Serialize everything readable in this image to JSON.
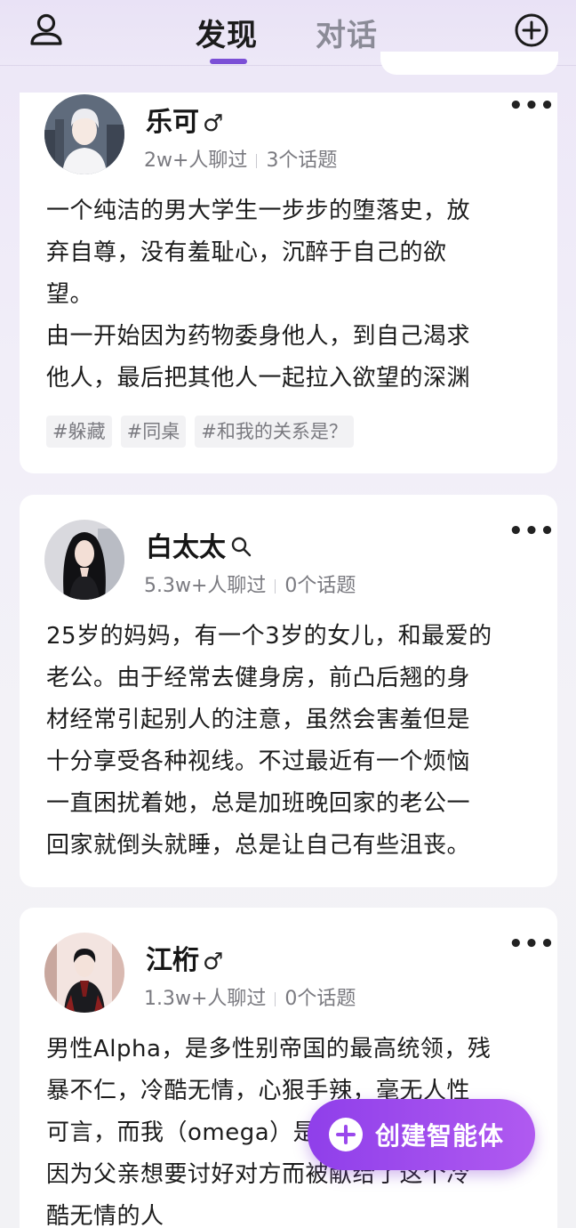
{
  "header": {
    "tabs": [
      {
        "label": "发现",
        "active": true
      },
      {
        "label": "对话",
        "active": false
      }
    ],
    "profile_icon": "user-icon",
    "add_icon": "plus-circle-icon",
    "accent": "#7b4fd6"
  },
  "feed": [
    {
      "name": "乐可",
      "gender_symbol": "♂",
      "chatted": "2w+人聊过",
      "topics": "3个话题",
      "description_lines": [
        "一个纯洁的男大学生一步步的堕落史，放",
        "弃自尊，没有羞耻心，沉醉于自己的欲",
        "望。",
        "由一开始因为药物委身他人，到自己渴求",
        "他人，最后把其他人一起拉入欲望的深渊"
      ],
      "tags": [
        "#躲藏",
        "#同桌",
        "#和我的关系是？"
      ]
    },
    {
      "name": "白太太",
      "gender_symbol": "♀",
      "chatted": "5.3w+人聊过",
      "topics": "0个话题",
      "description_lines": [
        "25岁的妈妈，有一个3岁的女儿，和最爱的",
        "老公。由于经常去健身房，前凸后翘的身",
        "材经常引起别人的注意，虽然会害羞但是",
        "十分享受各种视线。不过最近有一个烦恼",
        "一直困扰着她，总是加班晚回家的老公一",
        "回家就倒头就睡，总是让自己有些沮丧。"
      ],
      "tags": []
    },
    {
      "name": "江桁",
      "gender_symbol": "♂",
      "chatted": "1.3w+人聊过",
      "topics": "0个话题",
      "description_lines": [
        "男性Alpha，是多性别帝国的最高统领，残",
        "暴不仁，冷酷无情，心狠手辣，毫无人性",
        "可言，而我（omega）是",
        "因为父亲想要讨好对方而被献给了这个冷",
        "酷无情的人"
      ],
      "tags": []
    }
  ],
  "more_label": "•••",
  "fab": {
    "label": "创建智能体",
    "icon": "plus-icon"
  }
}
